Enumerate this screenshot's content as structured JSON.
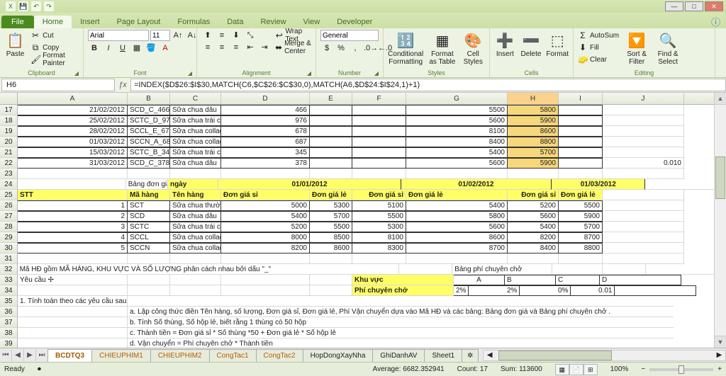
{
  "tabs": {
    "file": "File",
    "home": "Home",
    "insert": "Insert",
    "pagelayout": "Page Layout",
    "formulas": "Formulas",
    "data": "Data",
    "review": "Review",
    "view": "View",
    "developer": "Developer"
  },
  "clipboard": {
    "paste": "Paste",
    "cut": "Cut",
    "copy": "Copy",
    "fmt": "Format Painter",
    "label": "Clipboard"
  },
  "font": {
    "family": "Arial",
    "size": "11",
    "label": "Font"
  },
  "alignment": {
    "wrap": "Wrap Text",
    "merge": "Merge & Center",
    "label": "Alignment"
  },
  "number": {
    "style": "General",
    "label": "Number"
  },
  "styles": {
    "cond": "Conditional Formatting",
    "fat": "Format as Table",
    "cs": "Cell Styles",
    "label": "Styles"
  },
  "cells": {
    "ins": "Insert",
    "del": "Delete",
    "fmt": "Format",
    "label": "Cells"
  },
  "editing": {
    "sum": "AutoSum",
    "fill": "Fill",
    "clear": "Clear",
    "sort": "Sort & Filter",
    "find": "Find & Select",
    "label": "Editing"
  },
  "namebox": "H6",
  "formula": "=INDEX($D$26:$I$30,MATCH(C6,$C$26:$C$30,0),MATCH(A6,$D$24:$I$24,1)+1)",
  "cols": [
    "A",
    "B",
    "C",
    "D",
    "E",
    "F",
    "G",
    "H",
    "I",
    "J"
  ],
  "rows": {
    "17": {
      "n": "17",
      "A": "21/02/2012",
      "B": "SCD_C_466",
      "C": "Sữa chua dâu",
      "D": "466",
      "G": "5500",
      "H": "5800"
    },
    "18": {
      "n": "18",
      "A": "25/02/2012",
      "B": "SCTC_D_976",
      "C": "Sữa chua trái cây",
      "D": "976",
      "G": "5600",
      "H": "5900"
    },
    "19": {
      "n": "19",
      "A": "28/02/2012",
      "B": "SCCL_E_678",
      "C": "Sữa chua collagen lựu",
      "D": "678",
      "G": "8100",
      "H": "8600"
    },
    "20": {
      "n": "20",
      "A": "01/03/2012",
      "B": "SCCN_A_687",
      "C": "Sữa chua collagen nho",
      "D": "687",
      "G": "8400",
      "H": "8800"
    },
    "21": {
      "n": "21",
      "A": "15/03/2012",
      "B": "SCTC_B_345",
      "C": "Sữa chua trái cây",
      "D": "345",
      "G": "5400",
      "H": "5700"
    },
    "22": {
      "n": "22",
      "A": "31/03/2012",
      "B": "SCD_C_378",
      "C": "Sữa chua dâu",
      "D": "378",
      "G": "5600",
      "H": "5900",
      "J": "0.010"
    }
  },
  "row24": {
    "B": "Bảng đơn giá",
    "C": "ngày",
    "E": "01/01/2012",
    "G": "01/02/2012",
    "I": "01/03/2012"
  },
  "row25": {
    "A": "STT",
    "B": "Mã hàng",
    "C": "Tên hàng",
    "D": "Đơn giá sỉ",
    "E": "Đơn giá lẻ",
    "F": "Đơn giá sỉ",
    "G": "Đơn giá lẻ",
    "H": "Đơn giá sỉ",
    "I": "Đơn giá lẻ"
  },
  "tbl": [
    {
      "n": "26",
      "A": "1",
      "B": "SCT",
      "C": "Sữa chua thường",
      "D": "5000",
      "E": "5300",
      "F": "5100",
      "G": "5400",
      "H": "5200",
      "I": "5500"
    },
    {
      "n": "27",
      "A": "2",
      "B": "SCD",
      "C": "Sữa chua dâu",
      "D": "5400",
      "E": "5700",
      "F": "5500",
      "G": "5800",
      "H": "5600",
      "I": "5900"
    },
    {
      "n": "28",
      "A": "3",
      "B": "SCTC",
      "C": "Sữa chua trái cây",
      "D": "5200",
      "E": "5500",
      "F": "5300",
      "G": "5600",
      "H": "5400",
      "I": "5700"
    },
    {
      "n": "29",
      "A": "4",
      "B": "SCCL",
      "C": "Sữa chua collagen lựu",
      "D": "8000",
      "E": "8500",
      "F": "8100",
      "G": "8600",
      "H": "8200",
      "I": "8700"
    },
    {
      "n": "30",
      "A": "5",
      "B": "SCCN",
      "C": "Sữa chua collagen nho",
      "D": "8200",
      "E": "8600",
      "F": "8300",
      "G": "8700",
      "H": "8400",
      "I": "8800"
    }
  ],
  "r32": {
    "A": "Mã HĐ gồm MÃ HÀNG, KHU VỰC VÀ SỐ LƯỢNG phân cách nhau bởi dấu \"_\"",
    "G": "Bảng phí chuyên chở"
  },
  "r33": {
    "A": "Yêu cầu",
    "F": "Khu vực",
    "G": "A",
    "H": "B",
    "I": "C",
    "J": "D"
  },
  "r34": {
    "F": "Phí chuyên chở",
    "G": "2%",
    "H": "0%",
    "I": "0.01"
  },
  "r35": {
    "A": "1. Tính toán theo các yêu cầu sau"
  },
  "r36": {
    "B": "a. Lập công thức điền Tên hàng, số lượng, Đơn giá sỉ, Đơn giá lẻ, Phí Vận chuyển dựa vào Mã HĐ và các bảng: Bảng đơn giá và Bảng phí chuyên chở ."
  },
  "r37": {
    "B": "b. Tính Số thùng, Số hộp lẻ, biết rằng 1 thùng có 50 hộp"
  },
  "r38": {
    "B": "c. Thành tiền = Đơn giá sỉ * Số thùng *50 + Đơn giá lẻ * Số hộp lẻ"
  },
  "r39": {
    "B": "d. Vận chuyển = Phí chuyên chở * Thành tiền"
  },
  "r40": {
    "B": "e. Tổng cộng = Thành tiền + Vận chuyển"
  },
  "sheets": [
    "BCDTQ3",
    "CHIEUPHIM1",
    "CHIEUPHIM2",
    "CongTac1",
    "CongTac2",
    "HopDongXayNha",
    "GhiDanhAV",
    "Sheet1"
  ],
  "status": {
    "ready": "Ready",
    "avg": "Average: 6682.352941",
    "count": "Count: 17",
    "sum": "Sum: 113600",
    "zoom": "100%"
  }
}
